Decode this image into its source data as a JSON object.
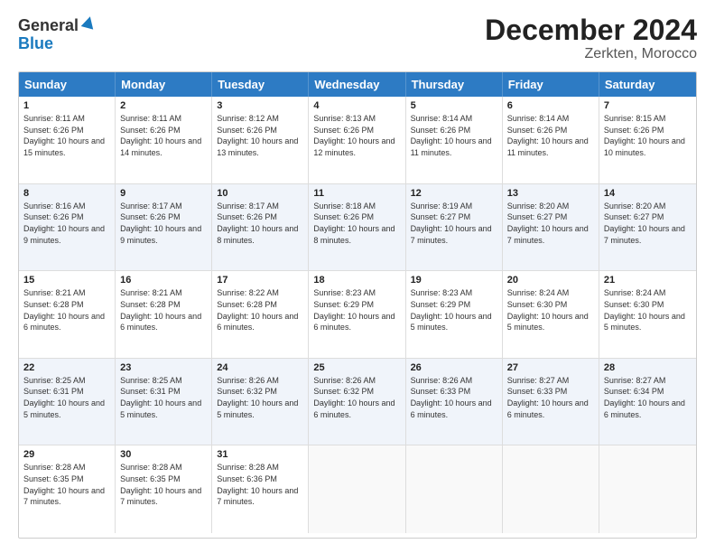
{
  "header": {
    "logo_general": "General",
    "logo_blue": "Blue",
    "title": "December 2024",
    "location": "Zerkten, Morocco"
  },
  "calendar": {
    "days_of_week": [
      "Sunday",
      "Monday",
      "Tuesday",
      "Wednesday",
      "Thursday",
      "Friday",
      "Saturday"
    ],
    "rows": [
      [
        {
          "day": "1",
          "sunrise": "8:11 AM",
          "sunset": "6:26 PM",
          "daylight": "10 hours and 15 minutes."
        },
        {
          "day": "2",
          "sunrise": "8:11 AM",
          "sunset": "6:26 PM",
          "daylight": "10 hours and 14 minutes."
        },
        {
          "day": "3",
          "sunrise": "8:12 AM",
          "sunset": "6:26 PM",
          "daylight": "10 hours and 13 minutes."
        },
        {
          "day": "4",
          "sunrise": "8:13 AM",
          "sunset": "6:26 PM",
          "daylight": "10 hours and 12 minutes."
        },
        {
          "day": "5",
          "sunrise": "8:14 AM",
          "sunset": "6:26 PM",
          "daylight": "10 hours and 11 minutes."
        },
        {
          "day": "6",
          "sunrise": "8:14 AM",
          "sunset": "6:26 PM",
          "daylight": "10 hours and 11 minutes."
        },
        {
          "day": "7",
          "sunrise": "8:15 AM",
          "sunset": "6:26 PM",
          "daylight": "10 hours and 10 minutes."
        }
      ],
      [
        {
          "day": "8",
          "sunrise": "8:16 AM",
          "sunset": "6:26 PM",
          "daylight": "10 hours and 9 minutes."
        },
        {
          "day": "9",
          "sunrise": "8:17 AM",
          "sunset": "6:26 PM",
          "daylight": "10 hours and 9 minutes."
        },
        {
          "day": "10",
          "sunrise": "8:17 AM",
          "sunset": "6:26 PM",
          "daylight": "10 hours and 8 minutes."
        },
        {
          "day": "11",
          "sunrise": "8:18 AM",
          "sunset": "6:26 PM",
          "daylight": "10 hours and 8 minutes."
        },
        {
          "day": "12",
          "sunrise": "8:19 AM",
          "sunset": "6:27 PM",
          "daylight": "10 hours and 7 minutes."
        },
        {
          "day": "13",
          "sunrise": "8:20 AM",
          "sunset": "6:27 PM",
          "daylight": "10 hours and 7 minutes."
        },
        {
          "day": "14",
          "sunrise": "8:20 AM",
          "sunset": "6:27 PM",
          "daylight": "10 hours and 7 minutes."
        }
      ],
      [
        {
          "day": "15",
          "sunrise": "8:21 AM",
          "sunset": "6:28 PM",
          "daylight": "10 hours and 6 minutes."
        },
        {
          "day": "16",
          "sunrise": "8:21 AM",
          "sunset": "6:28 PM",
          "daylight": "10 hours and 6 minutes."
        },
        {
          "day": "17",
          "sunrise": "8:22 AM",
          "sunset": "6:28 PM",
          "daylight": "10 hours and 6 minutes."
        },
        {
          "day": "18",
          "sunrise": "8:23 AM",
          "sunset": "6:29 PM",
          "daylight": "10 hours and 6 minutes."
        },
        {
          "day": "19",
          "sunrise": "8:23 AM",
          "sunset": "6:29 PM",
          "daylight": "10 hours and 5 minutes."
        },
        {
          "day": "20",
          "sunrise": "8:24 AM",
          "sunset": "6:30 PM",
          "daylight": "10 hours and 5 minutes."
        },
        {
          "day": "21",
          "sunrise": "8:24 AM",
          "sunset": "6:30 PM",
          "daylight": "10 hours and 5 minutes."
        }
      ],
      [
        {
          "day": "22",
          "sunrise": "8:25 AM",
          "sunset": "6:31 PM",
          "daylight": "10 hours and 5 minutes."
        },
        {
          "day": "23",
          "sunrise": "8:25 AM",
          "sunset": "6:31 PM",
          "daylight": "10 hours and 5 minutes."
        },
        {
          "day": "24",
          "sunrise": "8:26 AM",
          "sunset": "6:32 PM",
          "daylight": "10 hours and 5 minutes."
        },
        {
          "day": "25",
          "sunrise": "8:26 AM",
          "sunset": "6:32 PM",
          "daylight": "10 hours and 6 minutes."
        },
        {
          "day": "26",
          "sunrise": "8:26 AM",
          "sunset": "6:33 PM",
          "daylight": "10 hours and 6 minutes."
        },
        {
          "day": "27",
          "sunrise": "8:27 AM",
          "sunset": "6:33 PM",
          "daylight": "10 hours and 6 minutes."
        },
        {
          "day": "28",
          "sunrise": "8:27 AM",
          "sunset": "6:34 PM",
          "daylight": "10 hours and 6 minutes."
        }
      ],
      [
        {
          "day": "29",
          "sunrise": "8:28 AM",
          "sunset": "6:35 PM",
          "daylight": "10 hours and 7 minutes."
        },
        {
          "day": "30",
          "sunrise": "8:28 AM",
          "sunset": "6:35 PM",
          "daylight": "10 hours and 7 minutes."
        },
        {
          "day": "31",
          "sunrise": "8:28 AM",
          "sunset": "6:36 PM",
          "daylight": "10 hours and 7 minutes."
        },
        null,
        null,
        null,
        null
      ]
    ]
  }
}
